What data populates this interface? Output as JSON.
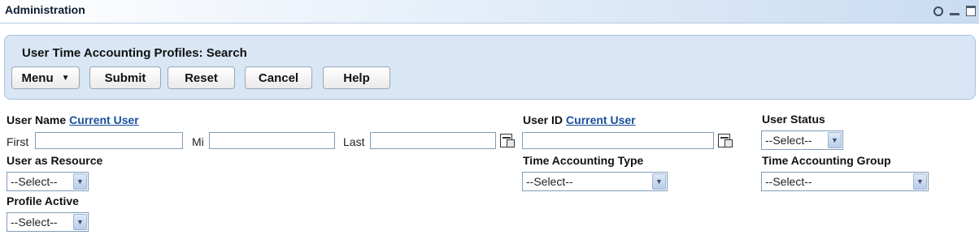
{
  "header": {
    "title": "Administration",
    "icons": [
      "refresh-icon",
      "minimize-icon",
      "maximize-icon"
    ]
  },
  "panel": {
    "title": "User Time Accounting Profiles: Search",
    "buttons": {
      "menu": "Menu",
      "submit": "Submit",
      "reset": "Reset",
      "cancel": "Cancel",
      "help": "Help"
    }
  },
  "form": {
    "user_name": {
      "label": "User Name",
      "link": "Current User",
      "first": "First",
      "mi": "Mi",
      "last": "Last"
    },
    "user_id": {
      "label": "User ID",
      "link": "Current User"
    },
    "user_status": {
      "label": "User Status",
      "value": "--Select--"
    },
    "user_as_resource": {
      "label": "User as Resource",
      "value": "--Select--"
    },
    "time_accounting_type": {
      "label": "Time Accounting Type",
      "value": "--Select--"
    },
    "time_accounting_group": {
      "label": "Time Accounting Group",
      "value": "--Select--"
    },
    "profile_active": {
      "label": "Profile Active",
      "value": "--Select--"
    }
  }
}
